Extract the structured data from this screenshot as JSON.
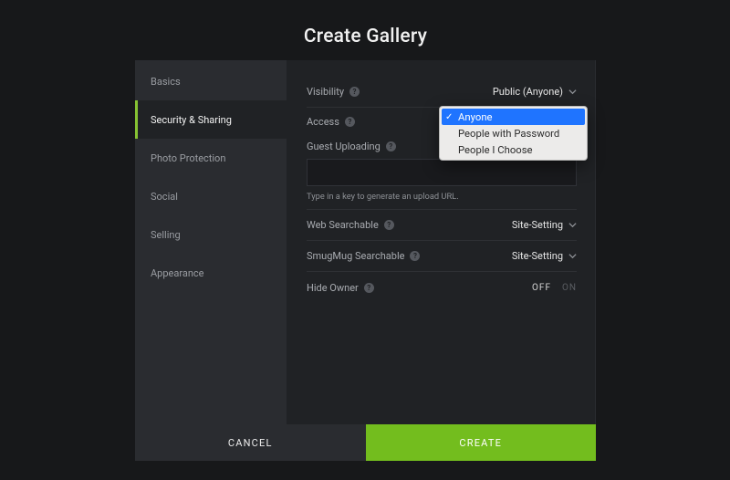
{
  "title": "Create Gallery",
  "sidebar": {
    "items": [
      {
        "label": "Basics"
      },
      {
        "label": "Security & Sharing"
      },
      {
        "label": "Photo Protection"
      },
      {
        "label": "Social"
      },
      {
        "label": "Selling"
      },
      {
        "label": "Appearance"
      }
    ],
    "activeIndex": 1
  },
  "fields": {
    "visibility": {
      "label": "Visibility",
      "value": "Public (Anyone)"
    },
    "access": {
      "label": "Access"
    },
    "guestUploading": {
      "label": "Guest Uploading",
      "hint": "Type in a key to generate an upload URL."
    },
    "webSearchable": {
      "label": "Web Searchable",
      "value": "Site-Setting"
    },
    "smugmugSearchable": {
      "label": "SmugMug Searchable",
      "value": "Site-Setting"
    },
    "hideOwner": {
      "label": "Hide Owner",
      "off": "OFF",
      "on": "ON"
    }
  },
  "dropdown": {
    "options": [
      "Anyone",
      "People with Password",
      "People I Choose"
    ],
    "selectedIndex": 0
  },
  "footer": {
    "cancel": "CANCEL",
    "create": "CREATE"
  },
  "helpGlyph": "?"
}
